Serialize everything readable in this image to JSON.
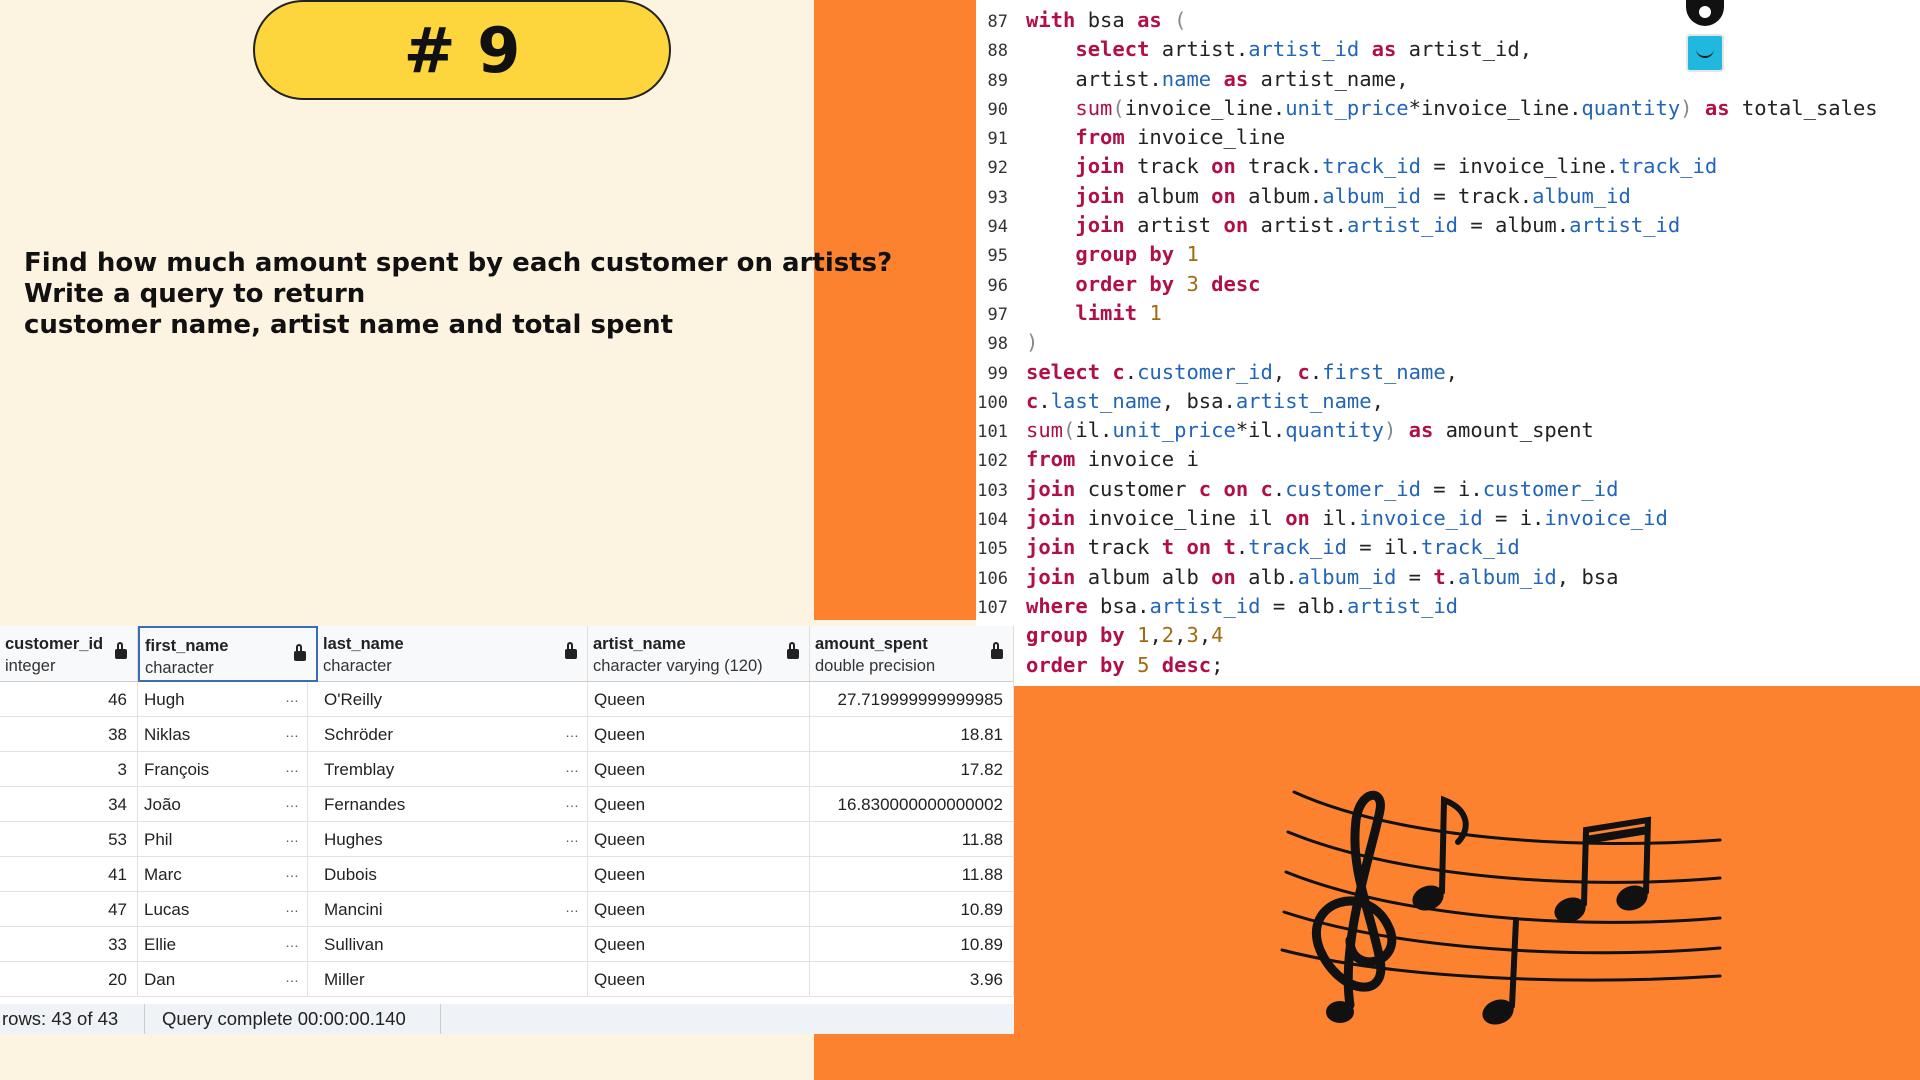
{
  "slide": {
    "badge": "# 9",
    "question_lines": [
      "Find how much amount spent by each customer on artists?",
      "Write a query to return",
      "customer name, artist name and total spent"
    ]
  },
  "editor": {
    "line_numbers": [
      "87",
      "88",
      "89",
      "90",
      "91",
      "92",
      "93",
      "94",
      "95",
      "96",
      "97",
      "98",
      "99",
      "100",
      "101",
      "102",
      "103",
      "104",
      "105",
      "106",
      "107"
    ]
  },
  "grid": {
    "columns": [
      {
        "name": "customer_id",
        "type": "integer"
      },
      {
        "name": "first_name",
        "type": "character"
      },
      {
        "name": "last_name",
        "type": "character"
      },
      {
        "name": "artist_name",
        "type": "character varying (120)"
      },
      {
        "name": "amount_spent",
        "type": "double precision"
      }
    ],
    "rows": [
      [
        "46",
        "Hugh",
        "O'Reilly",
        "Queen",
        "27.719999999999985"
      ],
      [
        "38",
        "Niklas",
        "Schröder",
        "Queen",
        "18.81"
      ],
      [
        "3",
        "François",
        "Tremblay",
        "Queen",
        "17.82"
      ],
      [
        "34",
        "João",
        "Fernandes",
        "Queen",
        "16.830000000000002"
      ],
      [
        "53",
        "Phil",
        "Hughes",
        "Queen",
        "11.88"
      ],
      [
        "41",
        "Marc",
        "Dubois",
        "Queen",
        "11.88"
      ],
      [
        "47",
        "Lucas",
        "Mancini",
        "Queen",
        "10.89"
      ],
      [
        "33",
        "Ellie",
        "Sullivan",
        "Queen",
        "10.89"
      ],
      [
        "20",
        "Dan",
        "Miller",
        "Queen",
        "3.96"
      ]
    ],
    "row_count_text": "rows: 43 of 43",
    "query_status": "Query complete 00:00:00.140"
  },
  "colors": {
    "orange": "#fc8230",
    "cream": "#fdf3e1",
    "badge_yellow": "#fdd53d",
    "keyword": "#b00f4a",
    "attribute": "#2264b8",
    "number": "#a06a10"
  },
  "icons": [
    "pen-tool-icon",
    "smile-square-icon",
    "lock-icon",
    "music-notes-illustration"
  ]
}
